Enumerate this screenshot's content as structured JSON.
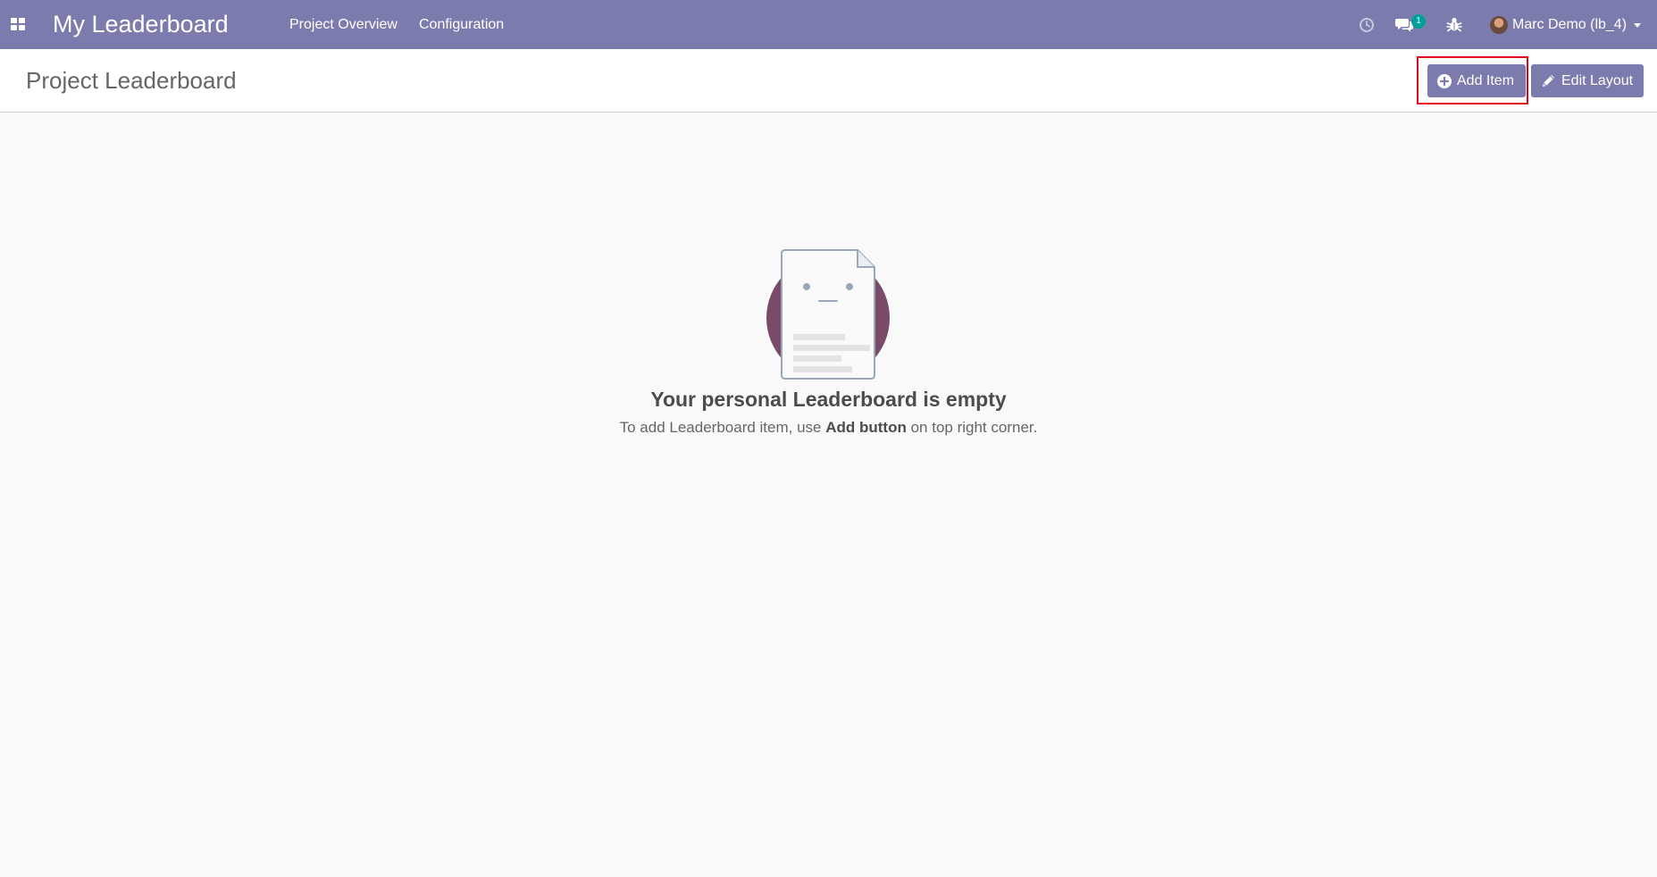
{
  "navbar": {
    "brand": "My Leaderboard",
    "menu": [
      "Project Overview",
      "Configuration"
    ],
    "chat_count": "1",
    "user_name": "Marc Demo (lb_4)",
    "icons": [
      "apps-icon",
      "clock-icon",
      "chat-icon",
      "bug-icon",
      "avatar",
      "caret-down-icon"
    ],
    "color": "#7c7bad"
  },
  "control_panel": {
    "title": "Project Leaderboard",
    "add_button": "Add Item",
    "edit_button": "Edit Layout",
    "highlight_color": "#e3061b"
  },
  "empty_state": {
    "title": "Your personal Leaderboard is empty",
    "text_before": "To add Leaderboard item, use ",
    "text_bold": "Add button",
    "text_after": " on top right corner.",
    "illustration_color": "#7a4a6b"
  }
}
